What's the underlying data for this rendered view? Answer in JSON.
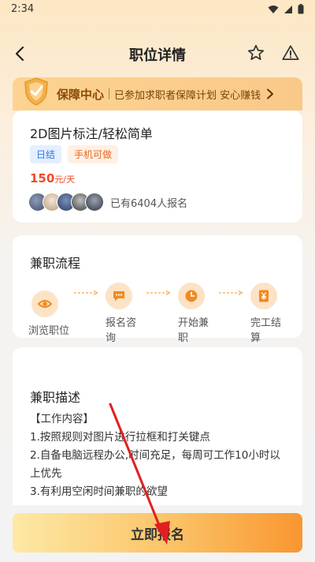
{
  "status_bar": {
    "time": "2:34"
  },
  "nav": {
    "title": "职位详情"
  },
  "guarantee": {
    "title": "保障中心",
    "description": "已参加求职者保障计划 安心赚钱"
  },
  "job": {
    "title": "2D图片标注/轻松简单",
    "tags": [
      "日结",
      "手机可做"
    ],
    "salary_value": "150",
    "salary_unit": "元/天",
    "applicants_text": "已有6404人报名"
  },
  "flow": {
    "title": "兼职流程",
    "steps": [
      {
        "label": "浏览职位",
        "icon": "eye-icon"
      },
      {
        "label": "报名咨询",
        "icon": "chat-icon"
      },
      {
        "label": "开始兼职",
        "icon": "clock-icon"
      },
      {
        "label": "完工结算",
        "icon": "money-receipt-icon"
      }
    ]
  },
  "description": {
    "title": "兼职描述",
    "lines": [
      "【工作内容】",
      "1.按照规则对图片进行拉框和打关键点",
      "2.自备电脑远程办公,时间充足，每周可工作10小时以上优先",
      "3.有利用空闲时间兼职的欲望"
    ]
  },
  "apply_button": {
    "label": "立即报名"
  },
  "colors": {
    "accent": "#f99630",
    "salary": "#f04a2a",
    "brand_brown": "#8a4a06",
    "annotation_arrow": "#e02020"
  }
}
